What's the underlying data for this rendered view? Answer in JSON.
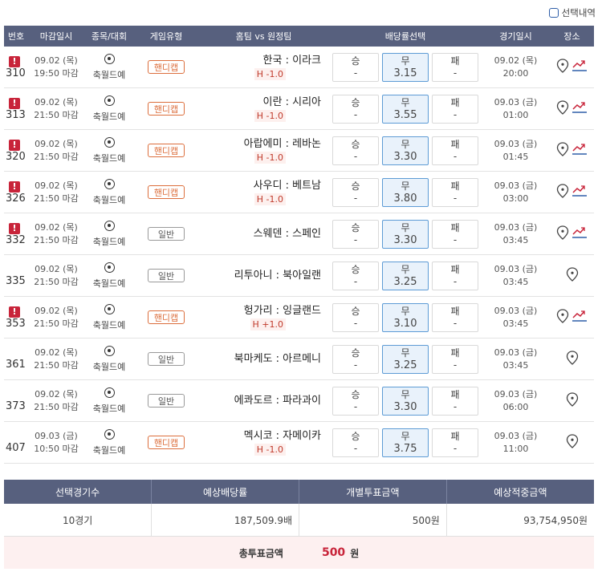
{
  "topbar": {
    "history_label": "선택내역"
  },
  "headers": {
    "no": "번호",
    "deadline": "마감일시",
    "sport": "종목/대회",
    "gtype": "게임유형",
    "teams": "홈팀 vs 원정팀",
    "odds": "배당률선택",
    "gdate": "경기일시",
    "place": "장소"
  },
  "odds_labels": {
    "win": "승",
    "draw": "무",
    "lose": "패",
    "dash": "-"
  },
  "games": [
    {
      "no": "310",
      "warn": true,
      "d1": "09.02 (목)",
      "d2": "19:50 마감",
      "sport": "축월드예",
      "type": "핸디캡",
      "handi": true,
      "match": "한국 : 이라크",
      "hc": "H -1.0",
      "draw": "3.15",
      "g1": "09.02 (목)",
      "g2": "20:00",
      "trend": true
    },
    {
      "no": "313",
      "warn": true,
      "d1": "09.02 (목)",
      "d2": "21:50 마감",
      "sport": "축월드예",
      "type": "핸디캡",
      "handi": true,
      "match": "이란 : 시리아",
      "hc": "H -1.0",
      "draw": "3.55",
      "g1": "09.03 (금)",
      "g2": "01:00",
      "trend": true
    },
    {
      "no": "320",
      "warn": true,
      "d1": "09.02 (목)",
      "d2": "21:50 마감",
      "sport": "축월드예",
      "type": "핸디캡",
      "handi": true,
      "match": "아랍에미 : 레바논",
      "hc": "H -1.0",
      "draw": "3.30",
      "g1": "09.03 (금)",
      "g2": "01:45",
      "trend": true
    },
    {
      "no": "326",
      "warn": true,
      "d1": "09.02 (목)",
      "d2": "21:50 마감",
      "sport": "축월드예",
      "type": "핸디캡",
      "handi": true,
      "match": "사우디 : 베트남",
      "hc": "H -1.0",
      "draw": "3.80",
      "g1": "09.03 (금)",
      "g2": "03:00",
      "trend": true
    },
    {
      "no": "332",
      "warn": true,
      "d1": "09.02 (목)",
      "d2": "21:50 마감",
      "sport": "축월드예",
      "type": "일반",
      "handi": false,
      "match": "스웨덴 : 스페인",
      "hc": "",
      "draw": "3.30",
      "g1": "09.03 (금)",
      "g2": "03:45",
      "trend": true
    },
    {
      "no": "335",
      "warn": false,
      "d1": "09.02 (목)",
      "d2": "21:50 마감",
      "sport": "축월드예",
      "type": "일반",
      "handi": false,
      "match": "리투아니 : 북아일랜",
      "hc": "",
      "draw": "3.25",
      "g1": "09.03 (금)",
      "g2": "03:45",
      "trend": false
    },
    {
      "no": "353",
      "warn": true,
      "d1": "09.02 (목)",
      "d2": "21:50 마감",
      "sport": "축월드예",
      "type": "핸디캡",
      "handi": true,
      "match": "헝가리 : 잉글랜드",
      "hc": "H +1.0",
      "draw": "3.10",
      "g1": "09.03 (금)",
      "g2": "03:45",
      "trend": true
    },
    {
      "no": "361",
      "warn": false,
      "d1": "09.02 (목)",
      "d2": "21:50 마감",
      "sport": "축월드예",
      "type": "일반",
      "handi": false,
      "match": "북마케도 : 아르메니",
      "hc": "",
      "draw": "3.25",
      "g1": "09.03 (금)",
      "g2": "03:45",
      "trend": false
    },
    {
      "no": "373",
      "warn": false,
      "d1": "09.02 (목)",
      "d2": "21:50 마감",
      "sport": "축월드예",
      "type": "일반",
      "handi": false,
      "match": "에콰도르 : 파라과이",
      "hc": "",
      "draw": "3.30",
      "g1": "09.03 (금)",
      "g2": "06:00",
      "trend": false
    },
    {
      "no": "407",
      "warn": false,
      "d1": "09.03 (금)",
      "d2": "10:50 마감",
      "sport": "축월드예",
      "type": "핸디캡",
      "handi": true,
      "match": "멕시코 : 자메이카",
      "hc": "H -1.0",
      "draw": "3.75",
      "g1": "09.03 (금)",
      "g2": "11:00",
      "trend": false
    }
  ],
  "summary": {
    "headers": [
      "선택경기수",
      "예상배당률",
      "개별투표금액",
      "예상적중금액"
    ],
    "values": [
      "10경기",
      "187,509.9배",
      "500원",
      "93,754,950원"
    ]
  },
  "total": {
    "label": "총투표금액",
    "amount": "500",
    "unit": "원"
  },
  "colors": {
    "header_bg": "#57607e",
    "handi": "#dc6e3c",
    "warn": "#c8243a",
    "selected_bg": "#e9f2fb",
    "selected_border": "#5d9bd5"
  }
}
